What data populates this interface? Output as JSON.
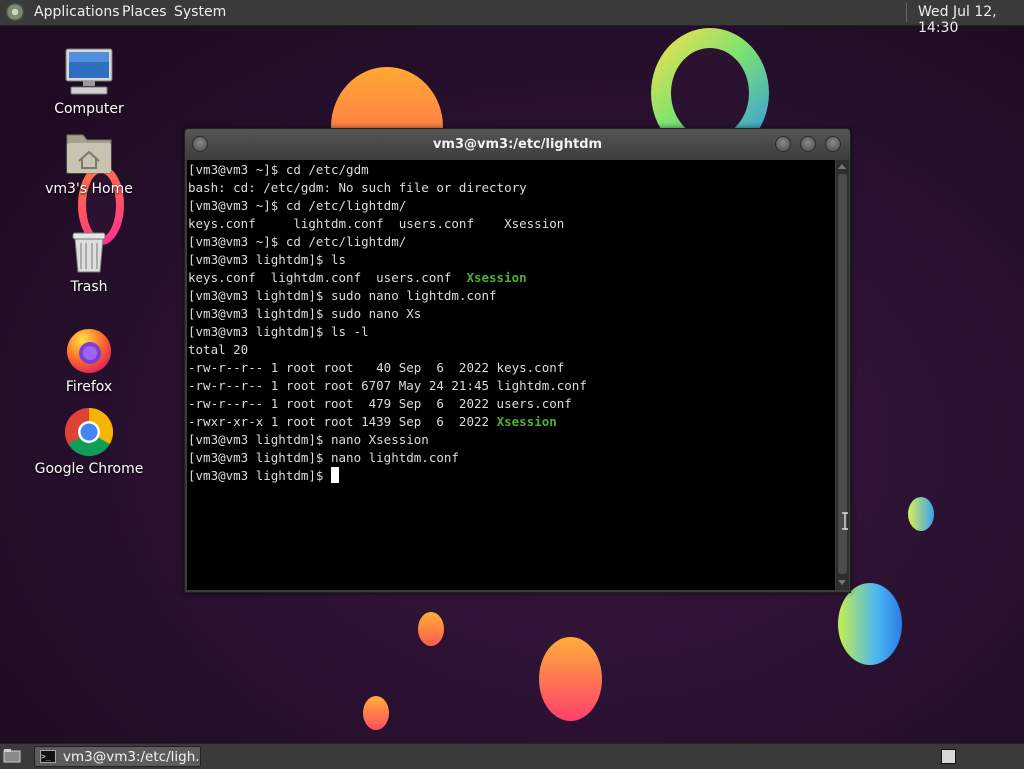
{
  "top_panel": {
    "menus": [
      {
        "label": "Applications"
      },
      {
        "label": "Places"
      },
      {
        "label": "System"
      }
    ],
    "clock": "Wed Jul 12, 14:30"
  },
  "desktop_icons": [
    {
      "label": "Computer",
      "icon": "computer-icon"
    },
    {
      "label": "vm3's Home",
      "icon": "home-folder-icon"
    },
    {
      "label": "Trash",
      "icon": "trash-icon"
    },
    {
      "label": "Firefox",
      "icon": "firefox-icon"
    },
    {
      "label": "Google Chrome",
      "icon": "chrome-icon"
    }
  ],
  "terminal": {
    "title": "vm3@vm3:/etc/lightdm",
    "lines": [
      "[vm3@vm3 ~]$ cd /etc/gdm",
      "bash: cd: /etc/gdm: No such file or directory",
      "[vm3@vm3 ~]$ cd /etc/lightdm/",
      "keys.conf     lightdm.conf  users.conf    Xsession",
      "[vm3@vm3 ~]$ cd /etc/lightdm/",
      "[vm3@vm3 lightdm]$ ls",
      {
        "before": "keys.conf  lightdm.conf  users.conf  ",
        "exe": "Xsession"
      },
      "[vm3@vm3 lightdm]$ sudo nano lightdm.conf",
      "[vm3@vm3 lightdm]$ sudo nano Xs",
      "[vm3@vm3 lightdm]$ ls -l",
      "total 20",
      "-rw-r--r-- 1 root root   40 Sep  6  2022 keys.conf",
      "-rw-r--r-- 1 root root 6707 May 24 21:45 lightdm.conf",
      "-rw-r--r-- 1 root root  479 Sep  6  2022 users.conf",
      {
        "before": "-rwxr-xr-x 1 root root 1439 Sep  6  2022 ",
        "exe": "Xsession"
      },
      "[vm3@vm3 lightdm]$ nano Xsession",
      "[vm3@vm3 lightdm]$ nano lightdm.conf"
    ],
    "prompt": "[vm3@vm3 lightdm]$ ",
    "exe_color": "#4bb135"
  },
  "taskbar": {
    "items": [
      {
        "label": "vm3@vm3:/etc/ligh...",
        "icon": "terminal-icon"
      }
    ]
  },
  "colors": {
    "panel": "#3a3a3a",
    "terminal_bg": "#000000",
    "terminal_fg": "#dcdcdc"
  }
}
